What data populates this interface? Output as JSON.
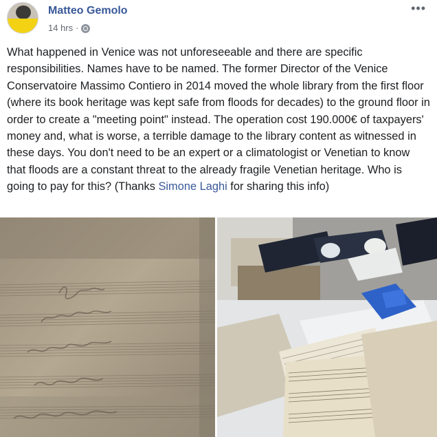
{
  "post": {
    "author": "Matteo Gemolo",
    "timestamp": "14 hrs",
    "separator": "·",
    "privacy_icon": "globe-icon",
    "more_label": "•••",
    "text_before_link": "What happened in Venice was not unforeseeable and there are specific responsibilities. Names have to be named. The former Director of the Venice Conservatoire Massimo Contiero in 2014 moved the whole library from the first floor (where its book heritage was kept safe from floods for decades) to the ground floor in order to create a \"meeting point\" instead. The operation cost 190.000€ of taxpayers' money and, what is worse, a terrible damage to the library content as witnessed in these days. You don't need to be an expert or a climatologist or Venetian to know that floods are a constant threat to the already fragile Venetian heritage. Who is going to pay for this? (Thanks ",
    "link_text": "Simone Laghi",
    "text_after_link": " for sharing this info)"
  },
  "colors": {
    "link": "#385898",
    "text": "#1c1e21",
    "meta": "#616770",
    "avatar_yellow": "#f3d214"
  }
}
